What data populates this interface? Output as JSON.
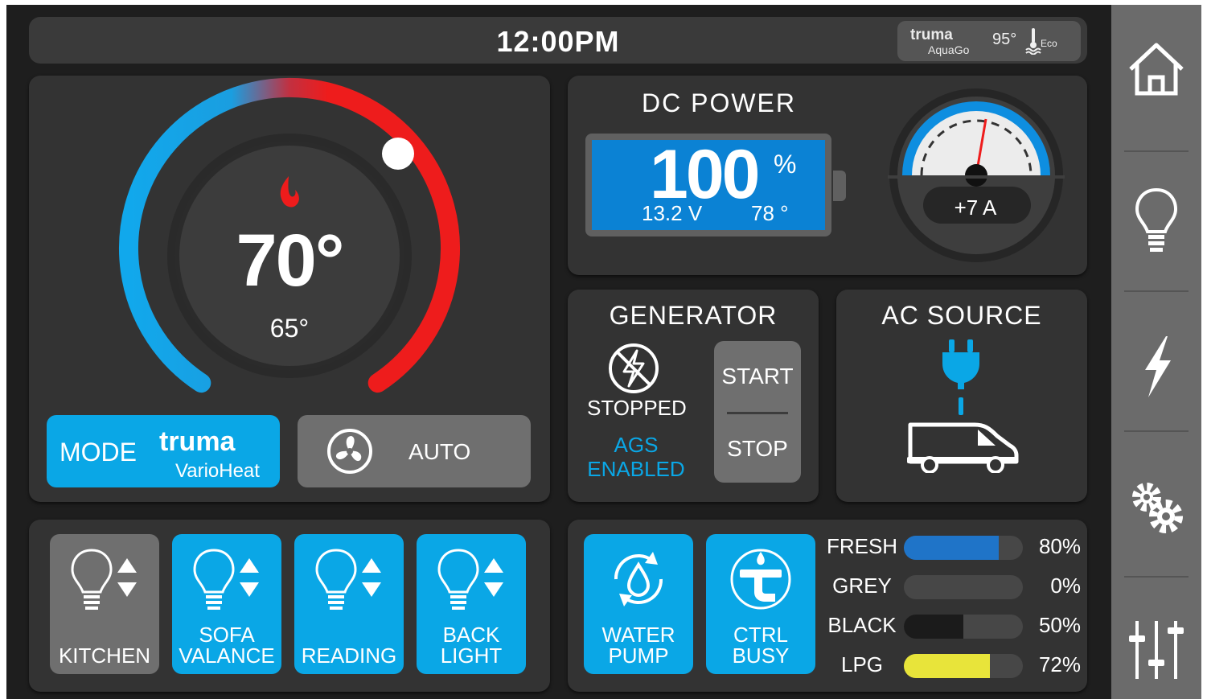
{
  "header": {
    "time": "12:00PM",
    "water_heater": {
      "brand": "truma",
      "model": "AquaGo",
      "temperature": "95°",
      "mode": "Eco"
    }
  },
  "heater": {
    "set_temperature": "70°",
    "current_temperature": "65°",
    "mode_label": "MODE",
    "brand": "truma",
    "model": "VarioHeat",
    "fan_label": "AUTO",
    "dial_level": 0.72
  },
  "dc_power": {
    "title": "DC POWER",
    "battery_percent": "100",
    "percent_sign": "%",
    "voltage": "13.2 V",
    "battery_temp": "78 °",
    "current": "+7 A"
  },
  "generator": {
    "title": "GENERATOR",
    "status": "STOPPED",
    "ags_line1": "AGS",
    "ags_line2": "ENABLED",
    "start_label": "START",
    "stop_label": "STOP"
  },
  "ac_source": {
    "title": "AC SOURCE"
  },
  "lights": [
    {
      "line1": "KITCHEN",
      "line2": "",
      "state": "off"
    },
    {
      "line1": "SOFA",
      "line2": "VALANCE",
      "state": "on"
    },
    {
      "line1": "READING",
      "line2": "",
      "state": "on"
    },
    {
      "line1": "BACK",
      "line2": "LIGHT",
      "state": "on"
    }
  ],
  "utilities": [
    {
      "line1": "WATER",
      "line2": "PUMP"
    },
    {
      "line1": "CTRL",
      "line2": "BUSY"
    }
  ],
  "tanks": [
    {
      "name": "FRESH",
      "value": "80%",
      "level": 0.8,
      "color": "#1f74c8"
    },
    {
      "name": "GREY",
      "value": "0%",
      "level": 0.0,
      "color": "#6a6a6a"
    },
    {
      "name": "BLACK",
      "value": "50%",
      "level": 0.5,
      "color": "#1b1b1b"
    },
    {
      "name": "LPG",
      "value": "72%",
      "level": 0.72,
      "color": "#e8e43a"
    }
  ],
  "colors": {
    "accent": "#0aa7e6",
    "heat": "#ee1c1c",
    "button_grey": "#6f6f6f",
    "panel": "#333333",
    "sidebar": "#6b6b6b"
  },
  "sidebar": {
    "items": [
      {
        "icon": "home-icon"
      },
      {
        "icon": "lightbulb-icon"
      },
      {
        "icon": "lightning-icon"
      },
      {
        "icon": "gears-icon"
      },
      {
        "icon": "sliders-icon"
      }
    ]
  }
}
